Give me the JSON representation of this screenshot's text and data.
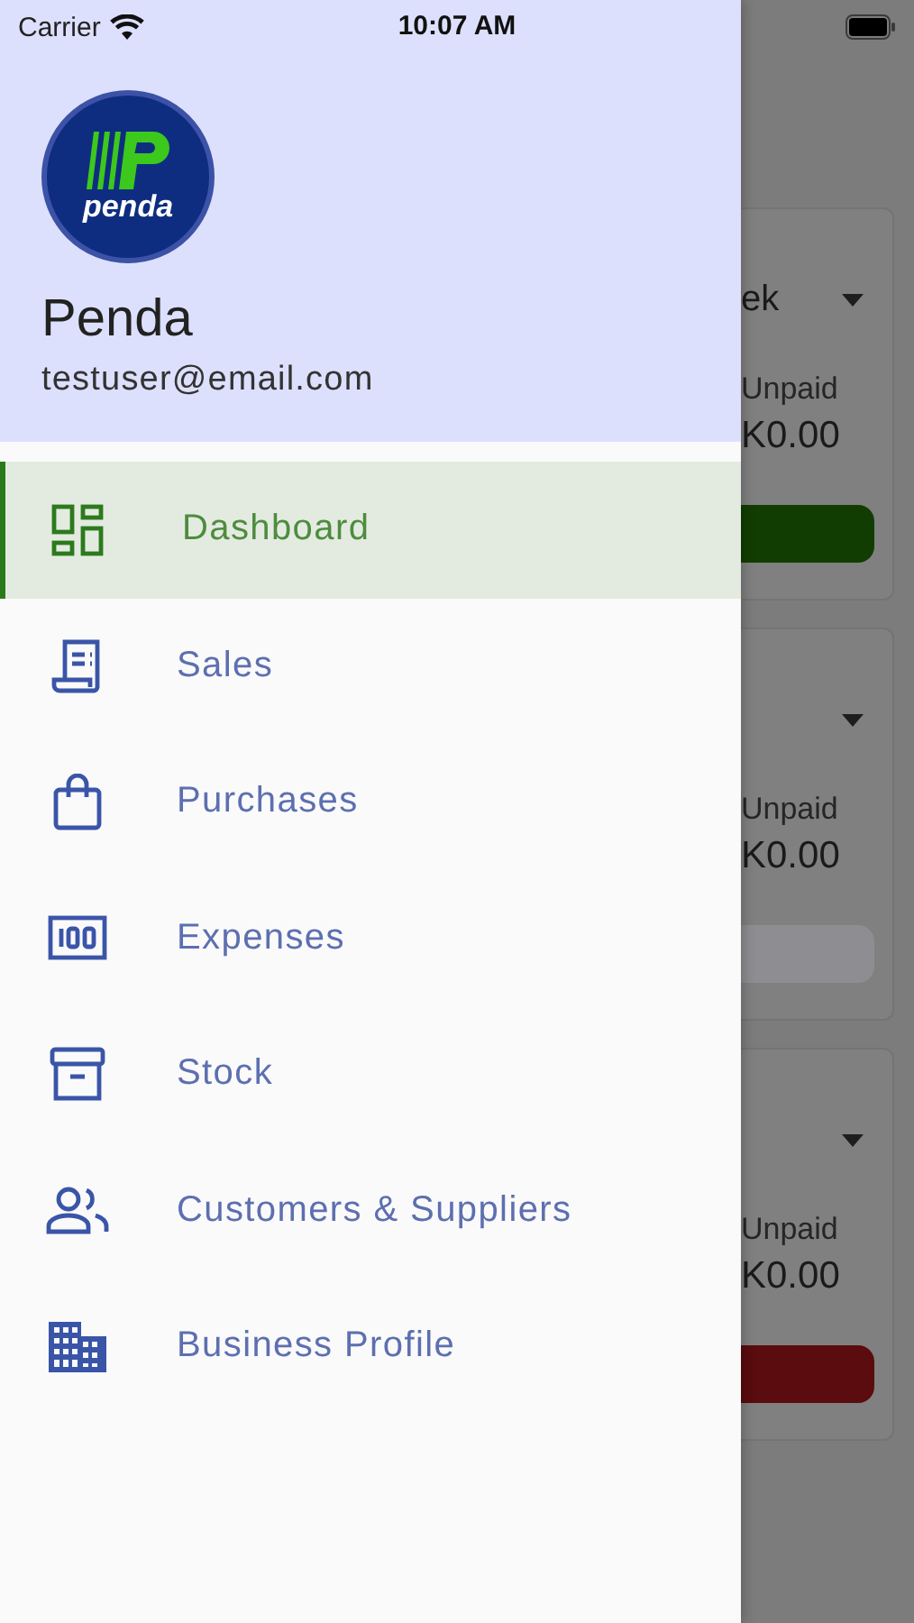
{
  "status_bar": {
    "carrier": "Carrier",
    "time": "10:07 AM"
  },
  "drawer": {
    "logo_text": "penda",
    "name": "Penda",
    "email": "testuser@email.com",
    "items": [
      {
        "label": "Dashboard",
        "kind": "dashboard",
        "selected": true
      },
      {
        "label": "Sales",
        "kind": "receipt",
        "selected": false
      },
      {
        "label": "Purchases",
        "kind": "bag",
        "selected": false
      },
      {
        "label": "Expenses",
        "kind": "money",
        "selected": false
      },
      {
        "label": "Stock",
        "kind": "archive",
        "selected": false
      },
      {
        "label": "Customers & Suppliers",
        "kind": "people",
        "selected": false
      },
      {
        "label": "Business Profile",
        "kind": "building",
        "selected": false
      }
    ]
  },
  "background_cards": [
    {
      "title": "ek",
      "label": "Unpaid",
      "amount": "K0.00",
      "color": "#123d02"
    },
    {
      "label": "Unpaid",
      "amount": "K0.00",
      "color": "#8e8e92"
    },
    {
      "label": "Unpaid",
      "amount": "K0.00",
      "color": "#5a0c0e"
    }
  ]
}
